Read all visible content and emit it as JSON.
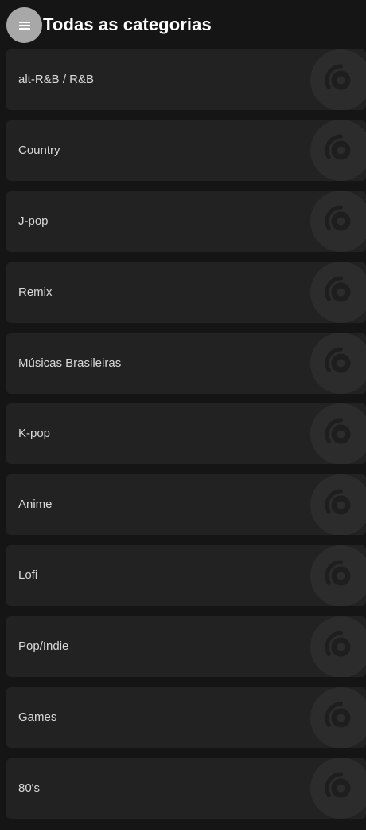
{
  "header": {
    "title": "Todas as categorias",
    "menu_icon": "hamburger-menu-icon"
  },
  "categories": [
    {
      "label": "alt-R&B / R&B",
      "icon": "vinyl-disc-icon"
    },
    {
      "label": "Country",
      "icon": "vinyl-disc-icon"
    },
    {
      "label": "J-pop",
      "icon": "vinyl-disc-icon"
    },
    {
      "label": "Remix",
      "icon": "vinyl-disc-icon"
    },
    {
      "label": "Músicas Brasileiras",
      "icon": "vinyl-disc-icon"
    },
    {
      "label": "K-pop",
      "icon": "vinyl-disc-icon"
    },
    {
      "label": "Anime",
      "icon": "vinyl-disc-icon"
    },
    {
      "label": "Lofi",
      "icon": "vinyl-disc-icon"
    },
    {
      "label": "Pop/Indie",
      "icon": "vinyl-disc-icon"
    },
    {
      "label": "Games",
      "icon": "vinyl-disc-icon"
    },
    {
      "label": "80's",
      "icon": "vinyl-disc-icon"
    }
  ],
  "colors": {
    "background": "#151515",
    "card": "#222222",
    "disc": "#2c2c2c",
    "disc_dark": "#1e1e1e",
    "menu_button": "#a8a8a8",
    "title_text": "#ffffff",
    "label_text": "#d9d9d9"
  }
}
